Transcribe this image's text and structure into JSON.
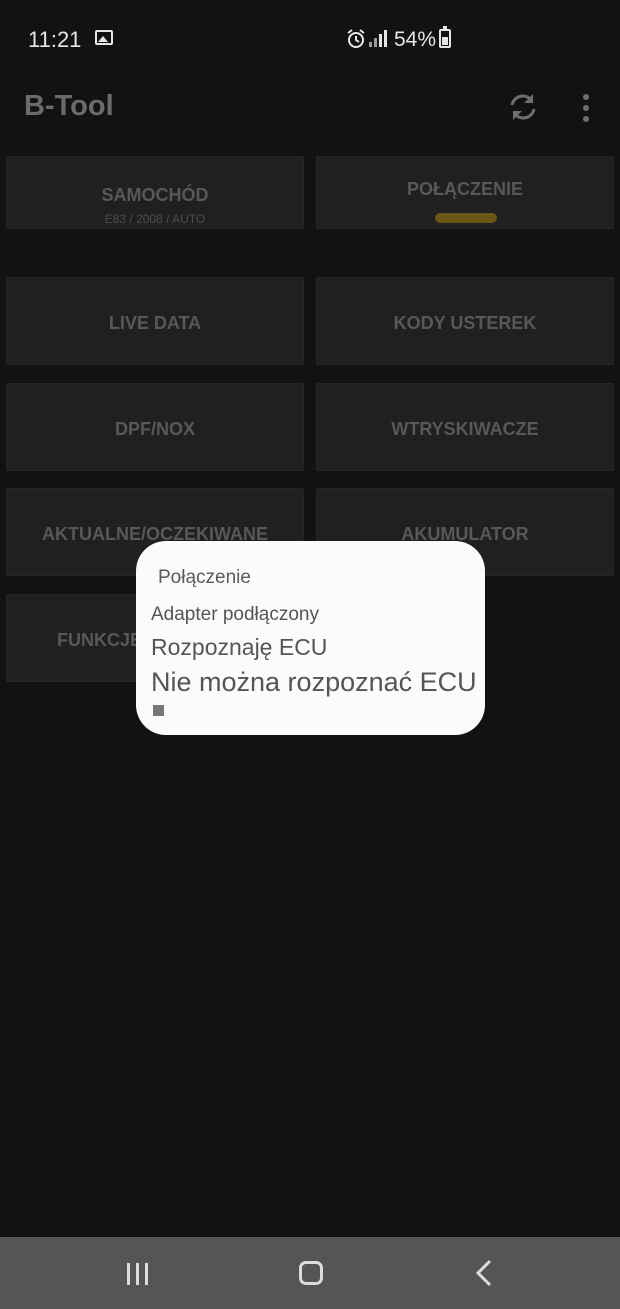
{
  "status_bar": {
    "time": "11:21",
    "battery": "54%",
    "battery_level": 0.54,
    "icons": [
      "image-icon",
      "alarm-icon",
      "signal-icon",
      "battery-icon"
    ]
  },
  "app_bar": {
    "title": "B-Tool",
    "icons": [
      "refresh-icon",
      "more-vert-icon"
    ]
  },
  "tiles": {
    "car": {
      "label": "SAMOCHÓD",
      "sub": "E83 / 2008 / AUTO"
    },
    "connection": {
      "label": "POŁĄCZENIE",
      "status_color": "#6a5716"
    },
    "live_data": {
      "label": "LIVE DATA"
    },
    "fault_codes": {
      "label": "KODY USTEREK"
    },
    "dpf_nox": {
      "label": "DPF/NOX"
    },
    "injectors": {
      "label": "WTRYSKIWACZE"
    },
    "actual_expected": {
      "label": "AKTUALNE/OCZEKIWANE"
    },
    "battery": {
      "label": "AKUMULATOR"
    },
    "functions": {
      "label": "FUNKCJE"
    }
  },
  "dialog": {
    "title": "Połączenie",
    "lines": [
      "Adapter podłączony",
      "Rozpoznaję ECU",
      "Nie można rozpoznać ECU"
    ],
    "stop_icon": "stop-icon"
  },
  "nav_bar": {
    "icons": [
      "recents-icon",
      "home-icon",
      "back-icon"
    ]
  },
  "colors": {
    "background": "#121212",
    "tile": "#202020",
    "dialog": "#fbfbfb",
    "nav_bar": "#555555"
  }
}
